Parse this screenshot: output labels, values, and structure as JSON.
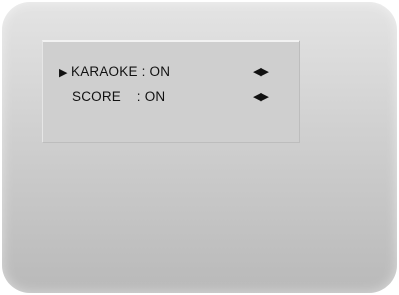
{
  "menu": {
    "items": [
      {
        "label": "KARAOKE : ON",
        "selected": true,
        "cursor": "▶",
        "arrows": "◀▶"
      },
      {
        "label": "SCORE    : ON",
        "selected": false,
        "cursor": "",
        "arrows": "◀▶"
      }
    ]
  },
  "colors": {
    "screen": "#d2d2d2",
    "panel": "#cfcfcf",
    "text": "#111111"
  }
}
